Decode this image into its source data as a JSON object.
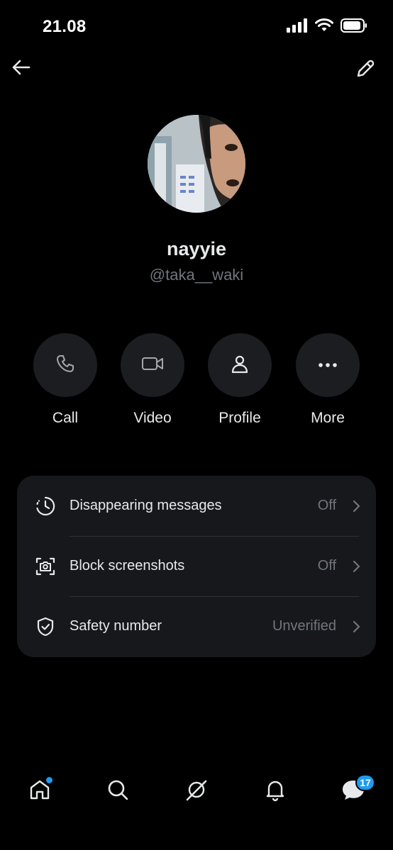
{
  "status_bar": {
    "time": "21.08"
  },
  "profile": {
    "name": "nayyie",
    "handle": "@taka__waki"
  },
  "actions": [
    {
      "label": "Call",
      "icon": "phone-icon"
    },
    {
      "label": "Video",
      "icon": "video-camera-icon"
    },
    {
      "label": "Profile",
      "icon": "person-icon"
    },
    {
      "label": "More",
      "icon": "more-dots-icon"
    }
  ],
  "settings": [
    {
      "label": "Disappearing messages",
      "value": "Off",
      "icon": "timer-icon"
    },
    {
      "label": "Block screenshots",
      "value": "Off",
      "icon": "screenshot-camera-icon"
    },
    {
      "label": "Safety number",
      "value": "Unverified",
      "icon": "shield-check-icon"
    }
  ],
  "bottom_nav": {
    "items": [
      "home-icon",
      "search-icon",
      "grok-icon",
      "bell-icon",
      "messages-icon"
    ],
    "messages_badge": "17"
  },
  "colors": {
    "accent": "#1d9bf0",
    "background": "#000000",
    "card": "#16181c",
    "muted": "#71767b"
  }
}
